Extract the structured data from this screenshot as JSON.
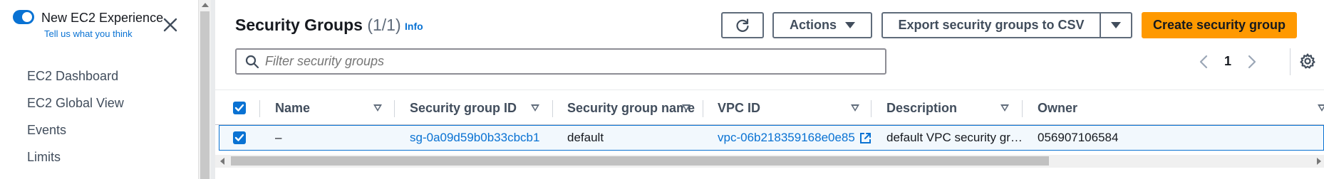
{
  "sidebar": {
    "experience_title": "New EC2 Experience",
    "experience_link": "Tell us what you think",
    "items": [
      {
        "label": "EC2 Dashboard"
      },
      {
        "label": "EC2 Global View"
      },
      {
        "label": "Events"
      },
      {
        "label": "Limits"
      }
    ]
  },
  "header": {
    "title": "Security Groups",
    "count": "(1/1)",
    "info_label": "Info"
  },
  "toolbar": {
    "actions_label": "Actions",
    "export_label": "Export security groups to CSV",
    "create_label": "Create security group"
  },
  "filter": {
    "placeholder": "Filter security groups"
  },
  "pagination": {
    "current_page": "1"
  },
  "table": {
    "columns": [
      {
        "label": "Name"
      },
      {
        "label": "Security group ID"
      },
      {
        "label": "Security group name"
      },
      {
        "label": "VPC ID"
      },
      {
        "label": "Description"
      },
      {
        "label": "Owner"
      }
    ],
    "rows": [
      {
        "name": "–",
        "security_group_id": "sg-0a09d59b0b33cbcb1",
        "security_group_name": "default",
        "vpc_id": "vpc-06b218359168e0e85",
        "description": "default VPC security gr…",
        "owner": "056907106584",
        "selected": true
      }
    ]
  },
  "colors": {
    "accent": "#0972d3",
    "primary_button": "#ff9900",
    "selected_row_bg": "#f2f8fd"
  }
}
